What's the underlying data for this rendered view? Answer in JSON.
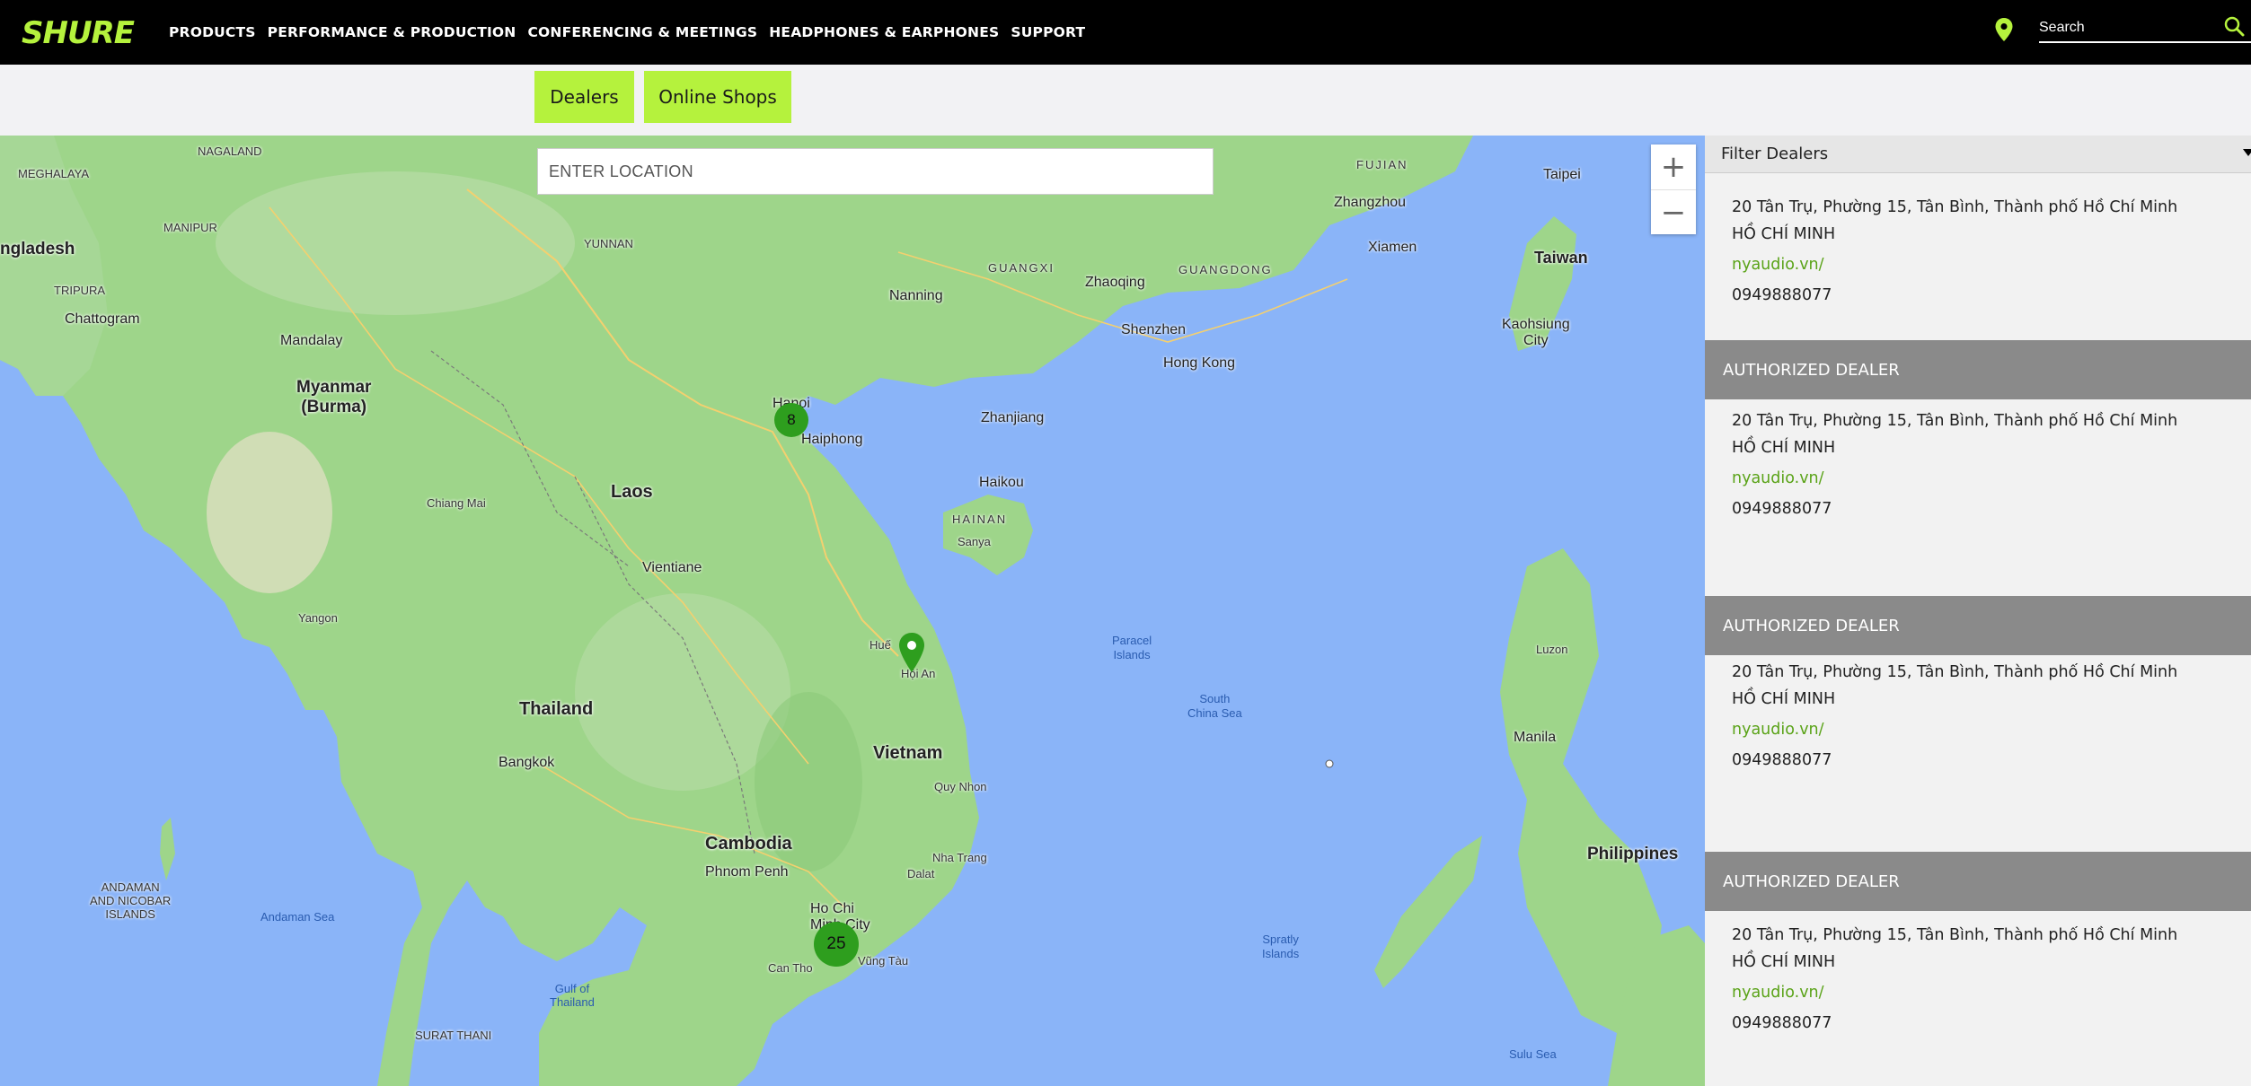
{
  "header": {
    "logo_text": "SHURE",
    "nav": [
      "PRODUCTS",
      "PERFORMANCE & PRODUCTION",
      "CONFERENCING & MEETINGS",
      "HEADPHONES & EARPHONES",
      "SUPPORT"
    ],
    "search_placeholder": "Search",
    "colors": {
      "background": "#000000",
      "accent": "#b5f23d"
    }
  },
  "tabs": {
    "dealers": "Dealers",
    "online_shops": "Online Shops"
  },
  "map": {
    "location_placeholder": "ENTER LOCATION",
    "zoom_in": "+",
    "zoom_out": "−",
    "clusters": {
      "north": "8",
      "south": "25"
    },
    "labels": {
      "nagaland": "NAGALAND",
      "meghalaya": "MEGHALAYA",
      "bangladesh": "ngladesh",
      "tripura": "TRIPURA",
      "manipur": "MANIPUR",
      "chattogram": "Chattogram",
      "mandalay": "Mandalay",
      "myanmar": "Myanmar\n(Burma)",
      "yunnan": "YUNNAN",
      "guangxi": "GUANGXI",
      "guangdong": "GUANGDONG",
      "fujian": "FUJIAN",
      "taiwan": "Taiwan",
      "taipei": "Taipei",
      "nanning": "Nanning",
      "zhaoqing": "Zhaoqing",
      "shenzhen": "Shenzhen",
      "hongkong": "Hong Kong",
      "zhangzhou": "Zhangzhou",
      "xiamen": "Xiamen",
      "kaohsiung": "Kaohsiung\nCity",
      "hanoi": "Hanoi",
      "haiphong": "Haiphong",
      "zhanjiang": "Zhanjiang",
      "haikou": "Haikou",
      "hainan": "HAINAN",
      "sanya": "Sanya",
      "laos": "Laos",
      "vientiane": "Vientiane",
      "thailand": "Thailand",
      "bangkok": "Bangkok",
      "cambodia": "Cambodia",
      "phnom_penh": "Phnom Penh",
      "vietnam": "Vietnam",
      "hoian": "Hội An",
      "hue": "Huế",
      "ho_chi_minh": "Ho Chi\nMinh City",
      "nha_trang": "Nha Trang",
      "paracel": "Paracel\nIslands",
      "south_china_sea": "South\nChina Sea",
      "spratly": "Spratly\nIslands",
      "philippines": "Philippines",
      "manila": "Manila",
      "luzon": "Luzon",
      "andaman_sea": "Andaman Sea",
      "andaman_islands": "ANDAMAN\nAND NICOBAR\nISLANDS",
      "gulf_thailand": "Gulf of\nThailand",
      "sulu_sea": "Sulu Sea",
      "yangon": "Yangon",
      "chiang_mai": "Chiang Mai",
      "surat_thani": "SURAT THANI",
      "can_tho": "Can Tho",
      "vung_tau": "Vũng Tàu",
      "quy_nhon": "Quy Nhon",
      "da_lat": "Dalat"
    }
  },
  "panel": {
    "filter_label": "Filter Dealers",
    "dealers": [
      {
        "header": "",
        "address": "20 Tân Trụ, Phường 15, Tân Bình, Thành phố Hồ Chí Minh",
        "city": "HỒ CHÍ MINH",
        "website": "nyaudio.vn/",
        "phone": "0949888077"
      },
      {
        "header": "AUTHORIZED DEALER",
        "address": "20 Tân Trụ, Phường 15, Tân Bình, Thành phố Hồ Chí Minh",
        "city": "HỒ CHÍ MINH",
        "website": "nyaudio.vn/",
        "phone": "0949888077"
      },
      {
        "header": "AUTHORIZED DEALER",
        "address": "20 Tân Trụ, Phường 15, Tân Bình, Thành phố Hồ Chí Minh",
        "city": "HỒ CHÍ MINH",
        "website": "nyaudio.vn/",
        "phone": "0949888077"
      },
      {
        "header": "AUTHORIZED DEALER",
        "address": "20 Tân Trụ, Phường 15, Tân Bình, Thành phố Hồ Chí Minh",
        "city": "HỒ CHÍ MINH",
        "website": "nyaudio.vn/",
        "phone": "0949888077"
      }
    ]
  }
}
